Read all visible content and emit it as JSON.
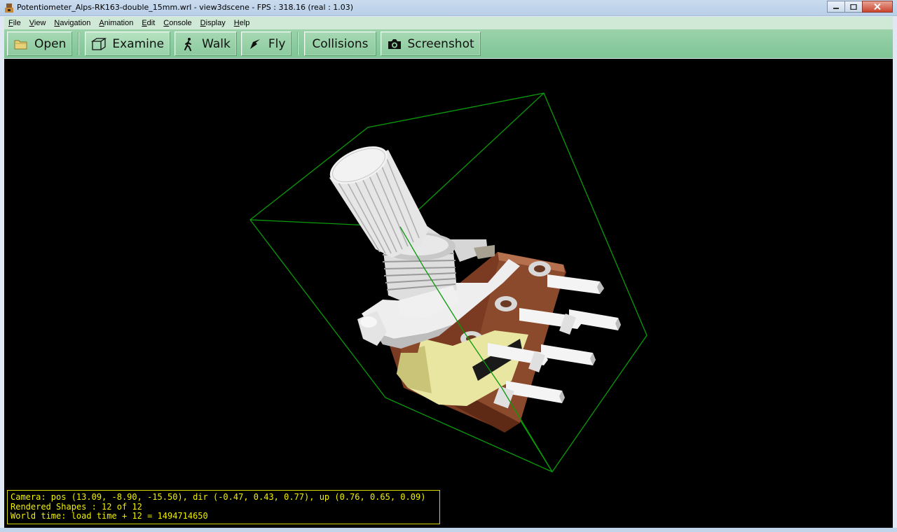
{
  "window": {
    "title": "Potentiometer_Alps-RK163-double_15mm.wrl - view3dscene - FPS : 318.16 (real : 1.03)",
    "controls": [
      "minimize-icon",
      "maximize-icon",
      "close-icon"
    ]
  },
  "menu": {
    "items": [
      {
        "key": "F",
        "rest": "ile"
      },
      {
        "key": "V",
        "rest": "iew"
      },
      {
        "key": "N",
        "rest": "avigation"
      },
      {
        "key": "A",
        "rest": "nimation"
      },
      {
        "key": "E",
        "rest": "dit"
      },
      {
        "key": "C",
        "rest": "onsole"
      },
      {
        "key": "D",
        "rest": "isplay"
      },
      {
        "key": "H",
        "rest": "elp"
      }
    ]
  },
  "toolbar": {
    "open": {
      "label": "Open",
      "icon": "folder-icon"
    },
    "examine": {
      "label": "Examine",
      "icon": "cube-icon"
    },
    "walk": {
      "label": "Walk",
      "icon": "walking-person-icon"
    },
    "fly": {
      "label": "Fly",
      "icon": "fly-icon"
    },
    "collisions": {
      "label": "Collisions"
    },
    "screenshot": {
      "label": "Screenshot",
      "icon": "camera-icon"
    }
  },
  "status": {
    "camera": "Camera: pos (13.09, -8.90, -15.50), dir (-0.47, 0.43, 0.77), up (0.76, 0.65, 0.09)",
    "shapes": "Rendered Shapes : 12 of 12",
    "time": "World time: load time + 12 = 1494714650"
  },
  "colors": {
    "viewport_bg": "#000000",
    "toolbar": "#8ccb9e",
    "menubar": "#cfe9d6",
    "status_text": "#f0f000",
    "bounding_box": "#0a9a0a",
    "board": "#7a3b22",
    "pins": "#f2f2f2",
    "body_cylinder": "#e8e6a0"
  }
}
